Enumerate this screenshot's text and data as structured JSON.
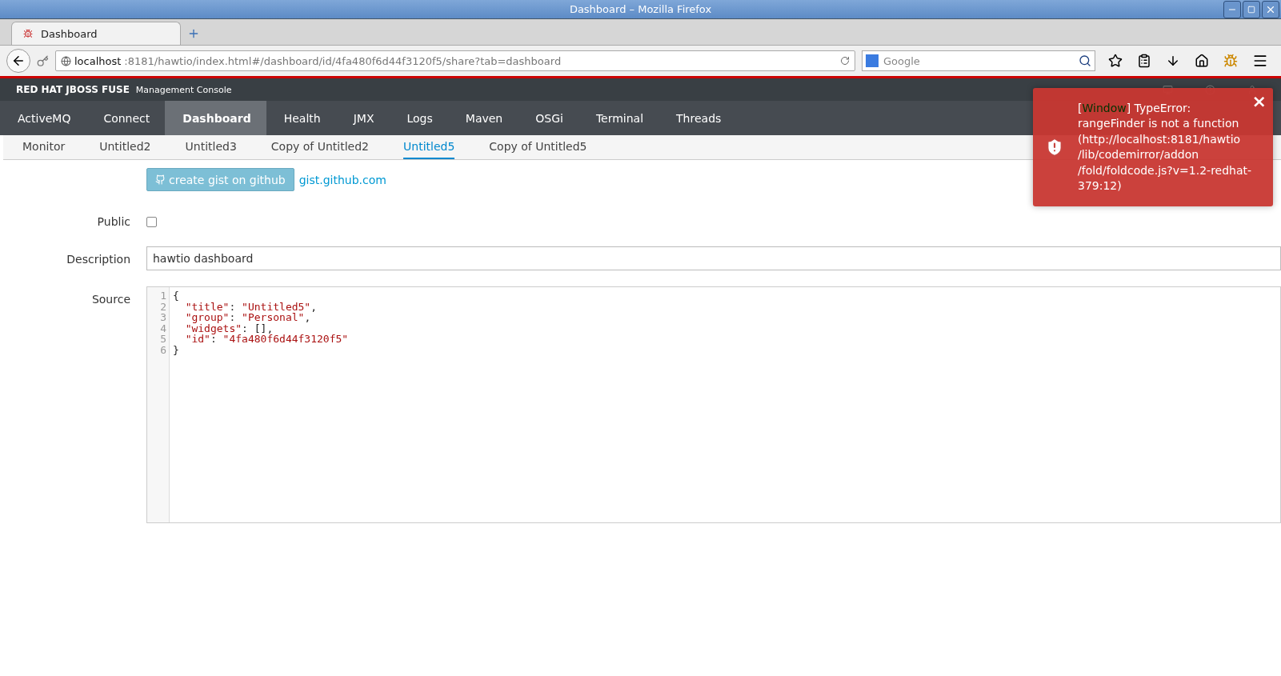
{
  "window": {
    "title": "Dashboard – Mozilla Firefox"
  },
  "browser_tabs": [
    {
      "label": "Dashboard",
      "selected": true
    }
  ],
  "address_bar": {
    "host": "localhost",
    "rest": ":8181/hawtio/index.html#/dashboard/id/4fa480f6d44f3120f5/share?tab=dashboard"
  },
  "search": {
    "placeholder": "Google"
  },
  "brand": {
    "name": "RED HAT JBOSS FUSE",
    "subtitle": "Management Console"
  },
  "nav": [
    {
      "label": "ActiveMQ",
      "selected": false
    },
    {
      "label": "Connect",
      "selected": false
    },
    {
      "label": "Dashboard",
      "selected": true
    },
    {
      "label": "Health",
      "selected": false
    },
    {
      "label": "JMX",
      "selected": false
    },
    {
      "label": "Logs",
      "selected": false
    },
    {
      "label": "Maven",
      "selected": false
    },
    {
      "label": "OSGi",
      "selected": false
    },
    {
      "label": "Terminal",
      "selected": false
    },
    {
      "label": "Threads",
      "selected": false
    }
  ],
  "subnav": [
    {
      "label": "Monitor",
      "selected": false
    },
    {
      "label": "Untitled2",
      "selected": false
    },
    {
      "label": "Untitled3",
      "selected": false
    },
    {
      "label": "Copy of Untitled2",
      "selected": false
    },
    {
      "label": "Untitled5",
      "selected": true
    },
    {
      "label": "Copy of Untitled5",
      "selected": false
    }
  ],
  "gist": {
    "button": "create gist on github",
    "link": "gist.github.com"
  },
  "form": {
    "public_label": "Public",
    "public_checked": false,
    "description_label": "Description",
    "description_value": "hawtio dashboard",
    "source_label": "Source"
  },
  "source_lines": [
    {
      "indented": false,
      "parts": [
        {
          "kind": "punct",
          "text": "{"
        }
      ]
    },
    {
      "indented": true,
      "parts": [
        {
          "kind": "string",
          "text": "\"title\""
        },
        {
          "kind": "punct",
          "text": ": "
        },
        {
          "kind": "string",
          "text": "\"Untitled5\""
        },
        {
          "kind": "punct",
          "text": ","
        }
      ]
    },
    {
      "indented": true,
      "parts": [
        {
          "kind": "string",
          "text": "\"group\""
        },
        {
          "kind": "punct",
          "text": ": "
        },
        {
          "kind": "string",
          "text": "\"Personal\""
        },
        {
          "kind": "punct",
          "text": ","
        }
      ]
    },
    {
      "indented": true,
      "parts": [
        {
          "kind": "string",
          "text": "\"widgets\""
        },
        {
          "kind": "punct",
          "text": ": [],"
        }
      ]
    },
    {
      "indented": true,
      "parts": [
        {
          "kind": "string",
          "text": "\"id\""
        },
        {
          "kind": "punct",
          "text": ": "
        },
        {
          "kind": "string",
          "text": "\"4fa480f6d44f3120f5\""
        }
      ]
    },
    {
      "indented": false,
      "parts": [
        {
          "kind": "punct",
          "text": "}"
        }
      ]
    }
  ],
  "line_numbers": [
    "1",
    "2",
    "3",
    "4",
    "5",
    "6"
  ],
  "toast": {
    "source": "Window",
    "message": "] TypeError: rangeFinder is not a function (http://localhost:8181/hawtio /lib/codemirror/addon /fold/foldcode.js?v=1.2-redhat-379:12)",
    "open_bracket": "[",
    "close": "×"
  }
}
